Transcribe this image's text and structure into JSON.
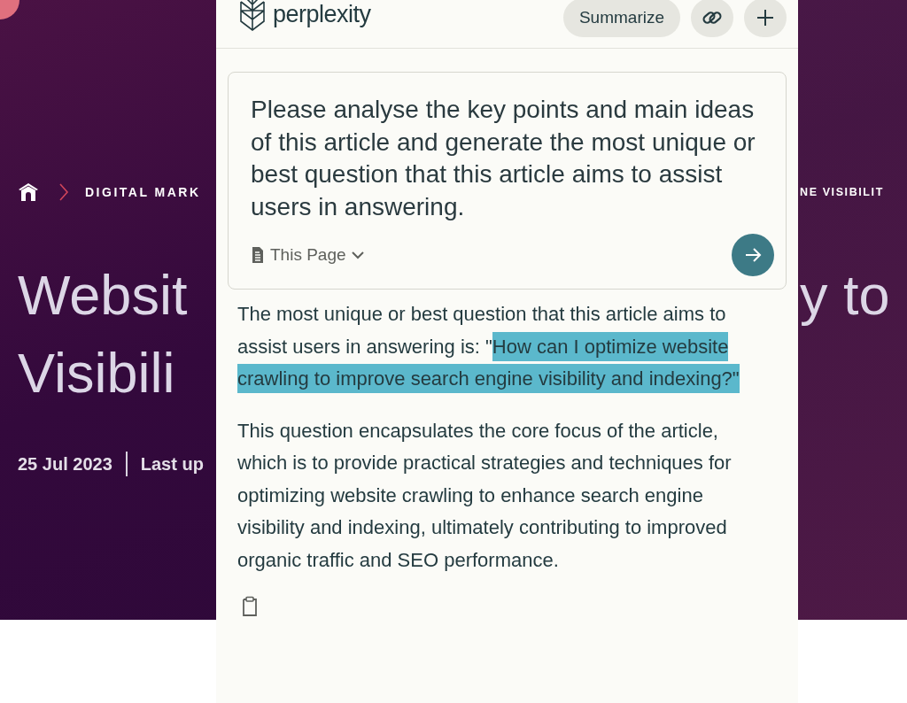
{
  "background_page": {
    "breadcrumb": {
      "left_text": "DIGITAL MARK",
      "right_text": "NE VISIBILIT"
    },
    "title": {
      "left_lines": [
        "Websit",
        "Visibili"
      ],
      "right_lines": [
        "y to"
      ]
    },
    "date": "25 Jul 2023",
    "last_updated": "Last up"
  },
  "panel": {
    "logo_text": "perplexity",
    "buttons": [
      {
        "kind": "text",
        "label": "Summarize"
      },
      {
        "kind": "link"
      },
      {
        "kind": "plus"
      }
    ],
    "query": {
      "text": "Please analyse the key points and main ideas of this article and generate the most unique or best question that this article aims to assist users in answering.",
      "source": "This Page"
    },
    "answer": {
      "paragraphs": [
        {
          "segments": [
            {
              "text": "The most unique or best question that this article aims to assist users in answering is: \"",
              "highlighted": false
            },
            {
              "text": "How can I optimize website crawling to improve search engine visibility and indexing?\"",
              "highlighted": true
            }
          ]
        },
        {
          "segments": [
            {
              "text": "This question encapsulates the core focus of the article, which is to provide practical strategies and techniques for optimizing website crawling to enhance search engine visibility and indexing, ultimately contributing to improved organic traffic and SEO performance.",
              "highlighted": false
            }
          ]
        }
      ]
    }
  }
}
